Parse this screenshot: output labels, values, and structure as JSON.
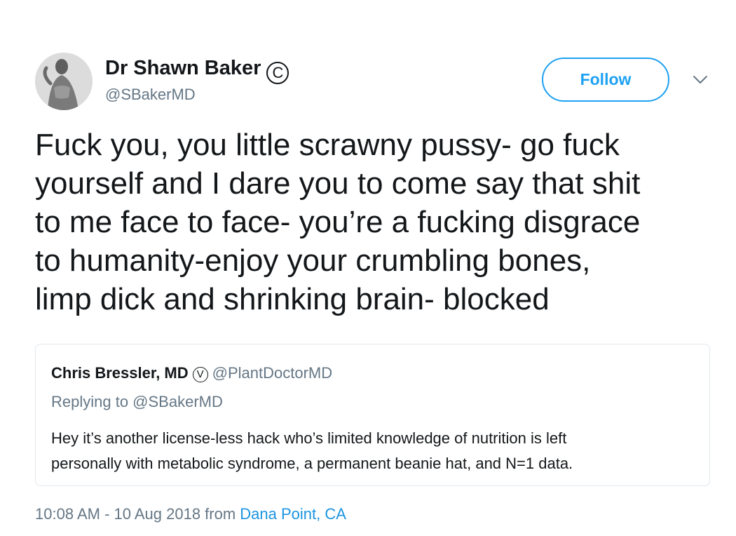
{
  "author": {
    "display_name": "Dr Shawn Baker",
    "badge_symbol": "C",
    "handle": "@SBakerMD"
  },
  "actions": {
    "follow_label": "Follow",
    "menu_icon": "chevron-down-icon"
  },
  "tweet": {
    "text": "Fuck you, you little scrawny pussy- go fuck\nyourself and I dare you to come say that shit\nto me face to face- you’re a fucking disgrace\nto humanity-enjoy your crumbling bones,\nlimp dick and shrinking brain- blocked"
  },
  "quoted_tweet": {
    "display_name": "Chris Bressler, MD",
    "badge_symbol": "V",
    "handle": "@PlantDoctorMD",
    "replying_to": "Replying to @SBakerMD",
    "text": "Hey it’s another license-less hack who’s limited knowledge of nutrition is left\npersonally with metabolic syndrome, a permanent beanie hat, and N=1 data."
  },
  "meta": {
    "timestamp": "10:08 AM - 10 Aug 2018 from ",
    "location": "Dana Point, CA"
  },
  "colors": {
    "accent": "#1da1f2",
    "link": "#1b95e0",
    "secondary_text": "#657786",
    "border": "#e1e8ed",
    "primary_text": "#14171a"
  }
}
